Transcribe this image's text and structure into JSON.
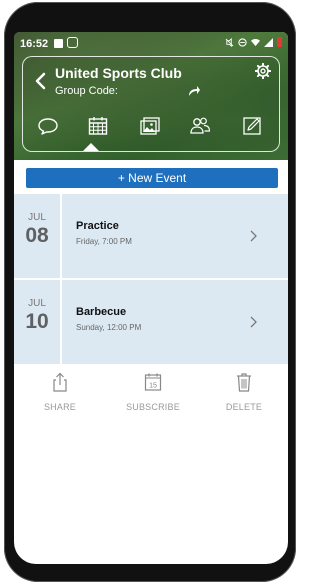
{
  "status_bar": {
    "time": "16:52"
  },
  "header": {
    "title": "United Sports Club",
    "group_code_label": "Group Code:",
    "tabs": [
      {
        "name": "chat"
      },
      {
        "name": "calendar",
        "active": true
      },
      {
        "name": "photos"
      },
      {
        "name": "members"
      },
      {
        "name": "notes"
      }
    ]
  },
  "new_event_label": "+ New Event",
  "events": [
    {
      "month": "JUL",
      "day": "08",
      "name": "Practice",
      "time": "Friday, 7:00 PM"
    },
    {
      "month": "JUL",
      "day": "10",
      "name": "Barbecue",
      "time": "Sunday, 12:00 PM"
    }
  ],
  "actions": {
    "share": "SHARE",
    "subscribe": "SUBSCRIBE",
    "subscribe_icon_number": "15",
    "delete": "DELETE"
  },
  "colors": {
    "accent": "#1f6fbf",
    "event_row_bg": "#dce9f3"
  }
}
